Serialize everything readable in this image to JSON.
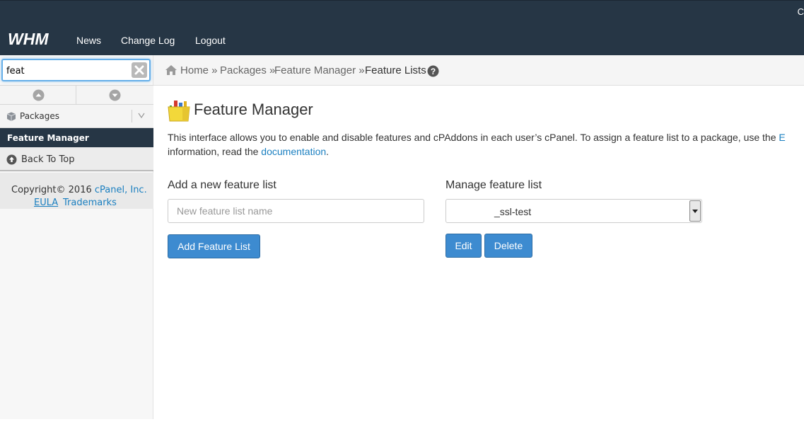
{
  "header": {
    "logo_text": "WHM",
    "nav": {
      "news": "News",
      "changelog": "Change Log",
      "logout": "Logout"
    },
    "corner_text": "C"
  },
  "sidebar": {
    "search": {
      "value": "feat"
    },
    "packages_label": "Packages",
    "active_item": "Feature Manager",
    "back_to_top": "Back To Top",
    "copyright_prefix": "Copyright© 2016 ",
    "copyright_link": "cPanel, Inc.",
    "eula": "EULA",
    "trademarks": "Trademarks"
  },
  "breadcrumb": {
    "home": "Home",
    "packages": "Packages",
    "feature_manager": "Feature Manager",
    "current": "Feature Lists",
    "separator": " »"
  },
  "main": {
    "title": "Feature Manager",
    "intro_line1": "This interface allows you to enable and disable features and cPAddons in each user’s cPanel. To assign a feature list to a package, use the ",
    "intro_line1_link": "E",
    "intro_line2_prefix": "information, read the ",
    "intro_link": "documentation",
    "intro_line2_suffix": ".",
    "add": {
      "label": "Add a new feature list",
      "placeholder": "New feature list name",
      "button": "Add Feature List"
    },
    "manage": {
      "label": "Manage feature list",
      "selected": "_ssl-test",
      "edit": "Edit",
      "delete": "Delete"
    }
  },
  "colors": {
    "header_bg": "#263645",
    "accent_blue": "#3d8bd0",
    "link_blue": "#1a7fc0"
  }
}
